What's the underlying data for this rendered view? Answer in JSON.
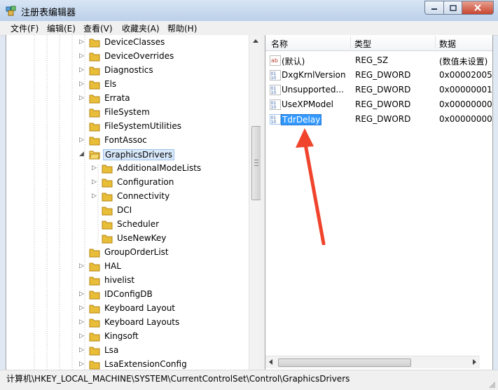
{
  "window": {
    "title": "注册表编辑器"
  },
  "menu": [
    {
      "name": "menu-file",
      "label": "文件(F)"
    },
    {
      "name": "menu-edit",
      "label": "编辑(E)"
    },
    {
      "name": "menu-view",
      "label": "查看(V)"
    },
    {
      "name": "menu-favorites",
      "label": "收藏夹(A)"
    },
    {
      "name": "menu-help",
      "label": "帮助(H)"
    }
  ],
  "tree": {
    "items": [
      {
        "label": "DeviceClasses",
        "expander": "▷"
      },
      {
        "label": "DeviceOverrides",
        "expander": "▷"
      },
      {
        "label": "Diagnostics",
        "expander": "▷"
      },
      {
        "label": "Els",
        "expander": "▷"
      },
      {
        "label": "Errata",
        "expander": "▷"
      },
      {
        "label": "FileSystem",
        "expander": ""
      },
      {
        "label": "FileSystemUtilities",
        "expander": ""
      },
      {
        "label": "FontAssoc",
        "expander": "▷"
      },
      {
        "label": "GraphicsDrivers",
        "expander": "◢",
        "selected": true
      },
      {
        "label": "AdditionalModeLists",
        "expander": "▷",
        "indent": 1
      },
      {
        "label": "Configuration",
        "expander": "▷",
        "indent": 1
      },
      {
        "label": "Connectivity",
        "expander": "▷",
        "indent": 1
      },
      {
        "label": "DCI",
        "expander": "",
        "indent": 1
      },
      {
        "label": "Scheduler",
        "expander": "",
        "indent": 1
      },
      {
        "label": "UseNewKey",
        "expander": "",
        "indent": 1
      },
      {
        "label": "GroupOrderList",
        "expander": ""
      },
      {
        "label": "HAL",
        "expander": "▷"
      },
      {
        "label": "hivelist",
        "expander": ""
      },
      {
        "label": "IDConfigDB",
        "expander": "▷"
      },
      {
        "label": "Keyboard Layout",
        "expander": "▷"
      },
      {
        "label": "Keyboard Layouts",
        "expander": "▷"
      },
      {
        "label": "Kingsoft",
        "expander": "▷"
      },
      {
        "label": "Lsa",
        "expander": "▷"
      },
      {
        "label": "LsaExtensionConfig",
        "expander": "▷"
      }
    ]
  },
  "list": {
    "headers": {
      "name": "名称",
      "type": "类型",
      "data": "数据"
    },
    "rows": [
      {
        "icon": "string-value-icon",
        "name": "(默认)",
        "type": "REG_SZ",
        "data": "(数值未设置)"
      },
      {
        "icon": "binary-value-icon",
        "name": "DxgKrnlVersion",
        "type": "REG_DWORD",
        "data": "0x00002005 ("
      },
      {
        "icon": "binary-value-icon",
        "name": "Unsupported...",
        "type": "REG_DWORD",
        "data": "0x00000001 ("
      },
      {
        "icon": "binary-value-icon",
        "name": "UseXPModel",
        "type": "REG_DWORD",
        "data": "0x00000000 ("
      },
      {
        "icon": "binary-value-icon",
        "name": "TdrDelay",
        "type": "REG_DWORD",
        "data": "0x00000000 (",
        "selected": true
      }
    ]
  },
  "status": {
    "path": "计算机\\HKEY_LOCAL_MACHINE\\SYSTEM\\CurrentControlSet\\Control\\GraphicsDrivers"
  },
  "colors": {
    "selection": "#3399ff",
    "folder": "#e8bd38",
    "annotation_arrow": "#f0442c"
  }
}
